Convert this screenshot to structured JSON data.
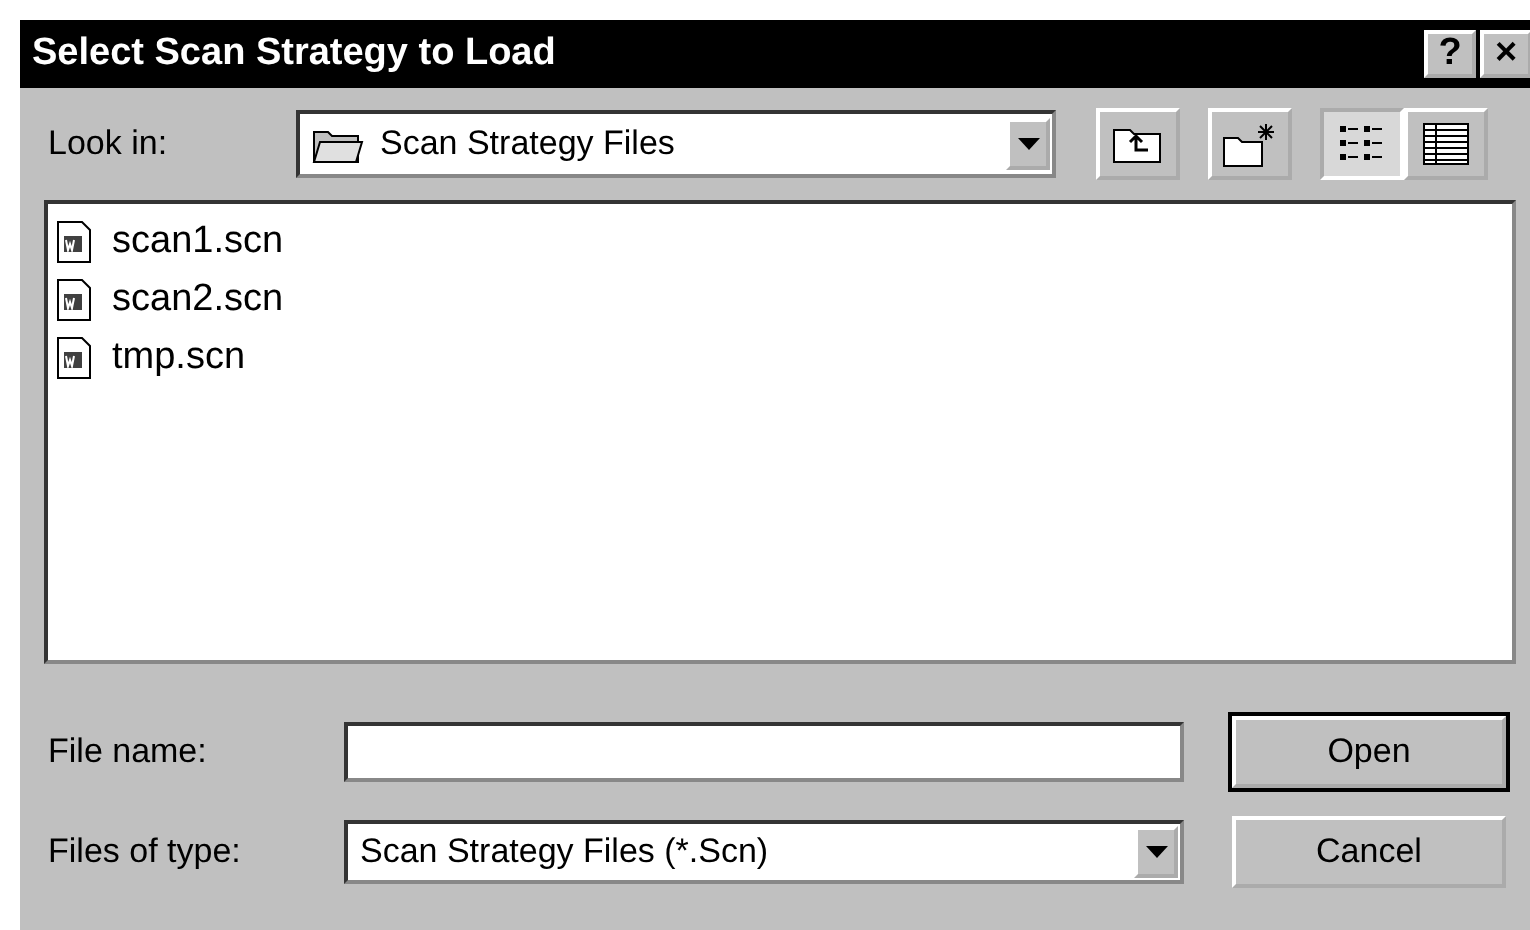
{
  "window": {
    "title": "Select Scan Strategy to Load",
    "title_buttons": [
      "?",
      "×"
    ]
  },
  "look_in": {
    "label": "Look in:",
    "value": "Scan Strategy Files"
  },
  "view_buttons": [
    {
      "kind": "list",
      "selected": true
    },
    {
      "kind": "details",
      "selected": false
    }
  ],
  "files": [
    {
      "name": "scan1.scn",
      "selected": false
    },
    {
      "name": "scan2.scn",
      "selected": false
    },
    {
      "name": "tmp.scn",
      "selected": false
    }
  ],
  "file_name": {
    "label": "File name:"
  },
  "file_type": {
    "label": "Files of type:",
    "value": "Scan Strategy Files (*.Scn)"
  },
  "buttons": [
    {
      "label": "Open",
      "default": true
    },
    {
      "label": "Cancel",
      "default": false
    }
  ]
}
